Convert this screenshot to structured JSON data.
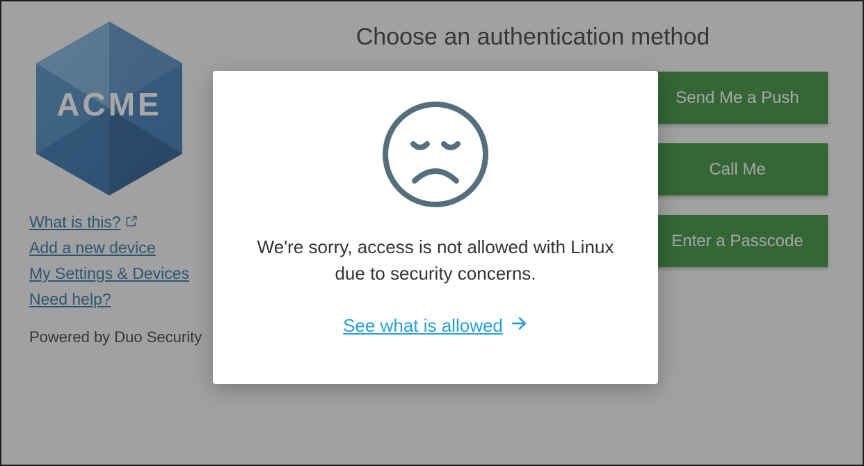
{
  "sidebar": {
    "logo_text": "ACME",
    "links": {
      "what_is_this": "What is this?",
      "add_device": "Add a new device",
      "settings_devices": "My Settings & Devices",
      "need_help": "Need help?"
    },
    "powered_by": "Powered by Duo Security"
  },
  "main": {
    "heading": "Choose an authentication method",
    "buttons": {
      "push": "Send Me a Push",
      "call": "Call Me",
      "passcode": "Enter a Passcode"
    }
  },
  "modal": {
    "message": "We're sorry, access is not allowed with Linux due to security concerns.",
    "allowed_link": "See what is allowed"
  },
  "colors": {
    "link": "#226b9e",
    "button": "#2f8a31",
    "modal_link": "#2a9fd6",
    "icon_stroke": "#556f7c"
  }
}
